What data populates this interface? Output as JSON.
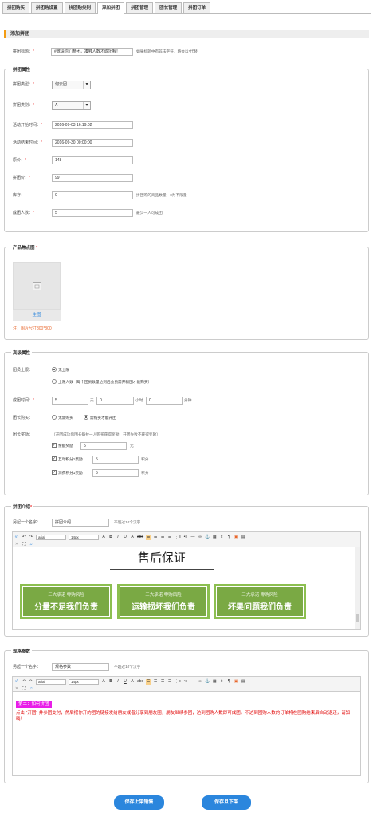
{
  "tabs": [
    "拼团购买",
    "拼团购设置",
    "拼团购类别",
    "添加拼团",
    "拼团管理",
    "团长管理",
    "拼团订单"
  ],
  "section_title": "添加拼团",
  "title_row": {
    "label": "拼团标题：",
    "value": "#邀请你们参团，凑够人数才成功喔！",
    "hint": "如果标题中有非法字符，将会以*代替"
  },
  "attrs": {
    "legend": "拼团属性",
    "type": {
      "label": "拼团类型：",
      "value": "何去团"
    },
    "category": {
      "label": "拼团类别：",
      "value": "A"
    },
    "start": {
      "label": "活动开始时间：",
      "value": "2016-09-03 16:19:02"
    },
    "end": {
      "label": "活动结束时间：",
      "value": "2016-09-30 00:00:00"
    },
    "orig_price": {
      "label": "原价：",
      "value": "148"
    },
    "group_price": {
      "label": "拼团价：",
      "value": "99"
    },
    "stock": {
      "label": "库存：",
      "value": "0",
      "hint": "拼团购的商品数量，0为不限量"
    },
    "members": {
      "label": "成团人数：",
      "value": "5",
      "hint": "最少一人可成团"
    }
  },
  "image": {
    "legend": "产品焦点图",
    "caption": "主图",
    "note": "注：图片尺寸800*800"
  },
  "advanced": {
    "legend": "高级属性",
    "limit": {
      "label": "团员上限：",
      "opt1": "无上限",
      "opt2": "上限人数（每个团员数量达到后会员需开新团才能购买）"
    },
    "duration": {
      "label": "成团时间：",
      "days": "5",
      "days_unit": "天",
      "hours": "0",
      "hours_unit": "小时",
      "mins": "0",
      "mins_unit": "分钟"
    },
    "leader_buy": {
      "label": "团长购买：",
      "opt1": "无需购买",
      "opt2": "需购买才能开团"
    },
    "reward": {
      "label": "团长奖励：",
      "desc": "（开团成功后团长每拉一人购买获得奖励，开团失败不获得奖励）",
      "items": [
        {
          "label": "余额奖励",
          "value": "5",
          "unit": "元"
        },
        {
          "label": "互动积分1奖励",
          "value": "5",
          "unit": "积分"
        },
        {
          "label": "消费积分1奖励",
          "value": "5",
          "unit": "积分"
        }
      ]
    }
  },
  "intro": {
    "legend": "拼团介绍",
    "name_label": "另起一个名字：",
    "name_value": "拼团介绍",
    "name_hint": "不超过10个汉字",
    "heading": "售后保证",
    "badges": [
      {
        "top": "三大承诺 零购风险",
        "main": "分量不足我们负责"
      },
      {
        "top": "三大承诺 零购风险",
        "main": "运输损坏我们负责"
      },
      {
        "top": "三大承诺 零购风险",
        "main": "坏果问题我们负责"
      }
    ]
  },
  "spec": {
    "legend": "规格参数",
    "name_label": "另起一个名字：",
    "name_value": "规格参数",
    "name_hint": "不超过10个汉字",
    "tag": "第二：如何拼团",
    "text": "点击 “开团” 并参团支付，然后把你开的团的链接发给朋友或者分享到朋友圈，朋友继续参团，达到团购人数即可成团。不达到团购人数的订单将在团购结束后自动退还，请知晓！"
  },
  "toolbar": {
    "font": "arial",
    "size": "14px"
  },
  "buttons": {
    "save_sale": "保存上架销售",
    "save_off": "保存且下架"
  },
  "colors": {
    "accent": "#f39c12",
    "required": "#e33333",
    "button": "#2b86dd",
    "badge": "#7aa944",
    "note": "#e8672c",
    "tag_bg": "#e81ee8",
    "red_text": "#e00000"
  }
}
